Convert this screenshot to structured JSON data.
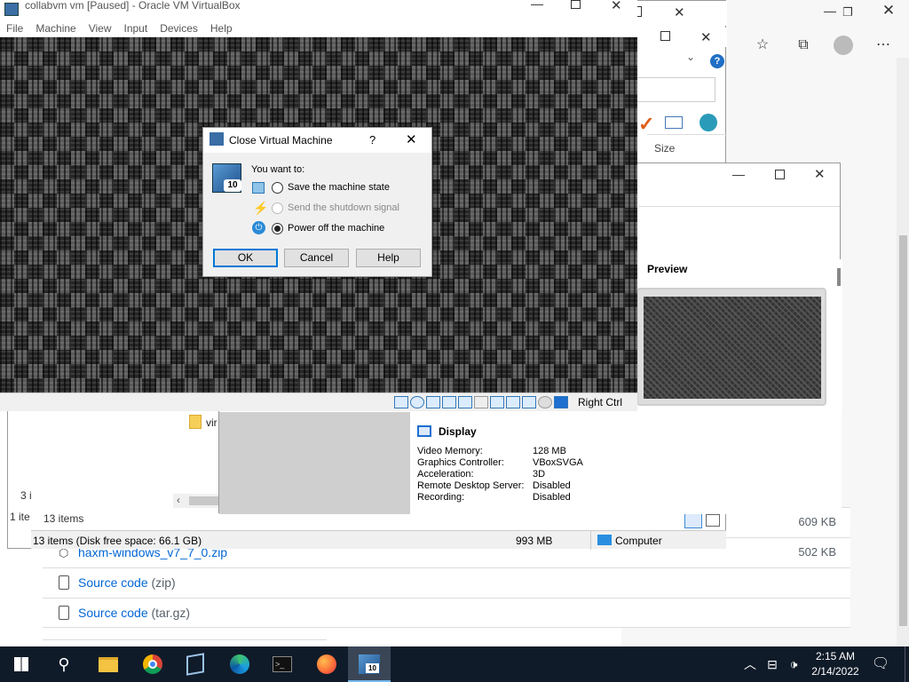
{
  "vm": {
    "title": "collabvm vm [Paused] - Oracle VM VirtualBox",
    "menu": [
      "File",
      "Machine",
      "View",
      "Input",
      "Devices",
      "Help"
    ],
    "host_key": "Right Ctrl"
  },
  "dialog": {
    "title": "Close Virtual Machine",
    "help_glyph": "?",
    "prompt": "You want to:",
    "options": [
      {
        "label": "Save the machine state",
        "selected": false,
        "enabled": true
      },
      {
        "label": "Send the shutdown signal",
        "selected": false,
        "enabled": false
      },
      {
        "label": "Power off the machine",
        "selected": true,
        "enabled": true
      }
    ],
    "buttons": {
      "ok": "OK",
      "cancel": "Cancel",
      "help": "Help"
    }
  },
  "details": {
    "preview_label": "Preview",
    "display_label": "Display",
    "display_rows": [
      {
        "key": "Video Memory:",
        "value": "128 MB"
      },
      {
        "key": "Graphics Controller:",
        "value": "VBoxSVGA"
      },
      {
        "key": "Acceleration:",
        "value": "3D"
      },
      {
        "key": "Remote Desktop Server:",
        "value": "Disabled"
      },
      {
        "key": "Recording:",
        "value": "Disabled"
      }
    ]
  },
  "explorer": {
    "size_header": "Size",
    "folder_name": "vir",
    "items_count": "13 items",
    "left_count_a": "3 i",
    "left_count_b": "1 ite",
    "status_items": "13 items (Disk free space: 66.1 GB)",
    "status_size": "993 MB",
    "status_location": "Computer"
  },
  "release_assets": [
    {
      "name": "haxm-windows_v7_7_0.zip",
      "size": "502 KB"
    },
    {
      "name": "Source code",
      "suffix": "(zip)",
      "size": ""
    },
    {
      "name": "Source code",
      "suffix": "(tar.gz)",
      "size": ""
    }
  ],
  "first_asset_size": "609 KB",
  "taskbar": {
    "time": "2:15 AM",
    "date": "2/14/2022"
  }
}
